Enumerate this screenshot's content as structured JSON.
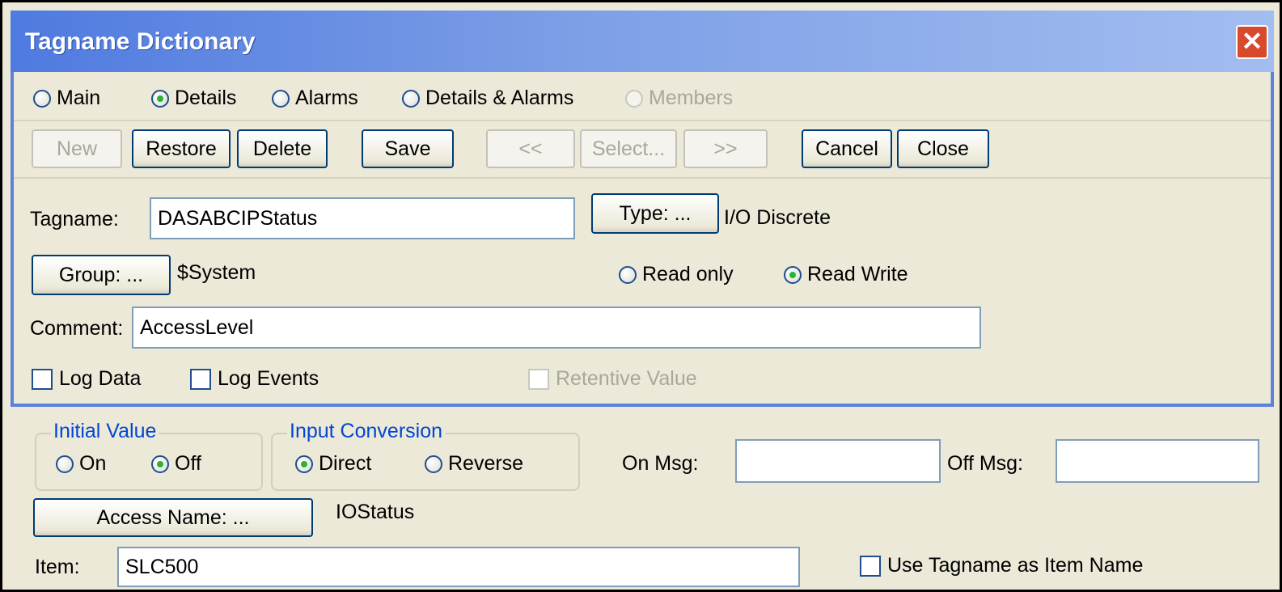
{
  "window": {
    "title": "Tagname Dictionary",
    "close_label": "✕"
  },
  "view_options": [
    {
      "label": "Main",
      "selected": false,
      "disabled": false
    },
    {
      "label": "Details",
      "selected": true,
      "disabled": false
    },
    {
      "label": "Alarms",
      "selected": false,
      "disabled": false
    },
    {
      "label": "Details & Alarms",
      "selected": false,
      "disabled": false
    },
    {
      "label": "Members",
      "selected": false,
      "disabled": true
    }
  ],
  "toolbar": {
    "new": "New",
    "restore": "Restore",
    "delete": "Delete",
    "save": "Save",
    "prev": "<<",
    "select": "Select...",
    "next": ">>",
    "cancel": "Cancel",
    "close": "Close"
  },
  "tag": {
    "tagname_label": "Tagname:",
    "tagname_value": "DASABCIPStatus",
    "type_button": "Type: ...",
    "type_value": "I/O Discrete",
    "group_button": "Group: ...",
    "group_value": "$System",
    "read_only": "Read only",
    "read_write": "Read Write",
    "comment_label": "Comment:",
    "comment_value": "AccessLevel",
    "log_data": "Log Data",
    "log_events": "Log Events",
    "retentive_value": "Retentive Value"
  },
  "details": {
    "initial_value_title": "Initial Value",
    "on": "On",
    "off": "Off",
    "input_conversion_title": "Input Conversion",
    "direct": "Direct",
    "reverse": "Reverse",
    "on_msg_label": "On Msg:",
    "on_msg_value": "",
    "off_msg_label": "Off Msg:",
    "off_msg_value": "",
    "access_name_button": "Access Name: ...",
    "access_name_value": "IOStatus",
    "item_label": "Item:",
    "item_value": "SLC500",
    "use_tagname_label": "Use Tagname as Item Name"
  }
}
